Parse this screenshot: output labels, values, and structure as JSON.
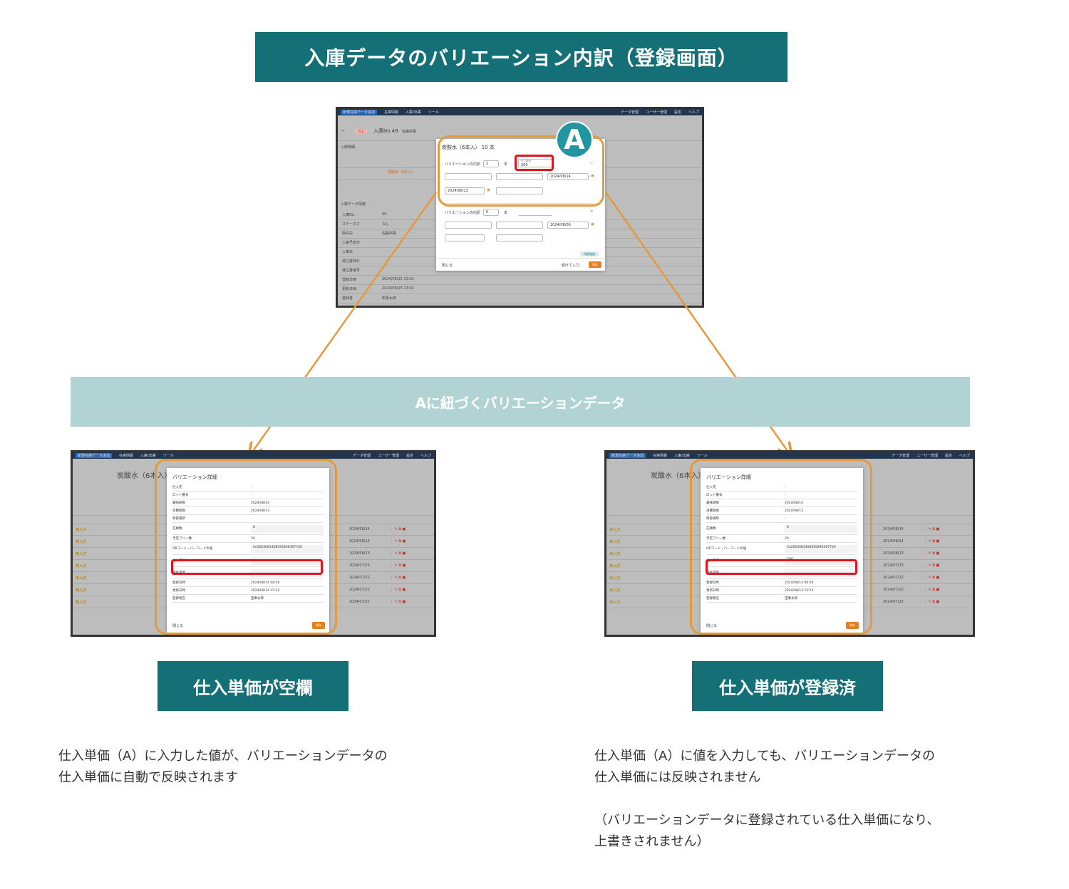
{
  "title": "入庫データのバリエーション内訳（登録画面）",
  "subtitle": "Aに紐づくバリエーションデータ",
  "marker": "A",
  "labels": {
    "left": "仕入単価が空欄",
    "right": "仕入単価が登録済"
  },
  "descriptions": {
    "left_line1": "仕入単価（A）に入力した値が、バリエーションデータの",
    "left_line2": "仕入単価に自動で反映されます",
    "right_line1": "仕入単価（A）に値を入力しても、バリエーションデータの",
    "right_line2": "仕入単価には反映されません",
    "right_line3": "（バリエーションデータに登録されている仕入単価になり、",
    "right_line4": "上書きされません）"
  },
  "app": {
    "nav": {
      "new": "新規在庫データ追加",
      "stock": "在庫情報",
      "inout": "入庫/出庫",
      "tools": "ツール",
      "data": "データ管理",
      "users": "ユーザー管理",
      "settings": "設定",
      "help": "ヘルプ"
    }
  },
  "top_shot": {
    "status": "なし",
    "header": "入庫No.49",
    "company": "佐藤商事",
    "section_items": "入庫明細",
    "section_info": "入庫データ情報",
    "info_rows": [
      {
        "k": "入庫No.",
        "v": "49"
      },
      {
        "k": "ステータス",
        "v": "なし"
      },
      {
        "k": "取引先",
        "v": "佐藤商事"
      },
      {
        "k": "入庫予定日",
        "v": ""
      },
      {
        "k": "入庫日",
        "v": ""
      },
      {
        "k": "発注書発行",
        "v": ""
      },
      {
        "k": "発注書番号",
        "v": ""
      },
      {
        "k": "登録日時",
        "v": "2024/08/15 13:02"
      },
      {
        "k": "更新日時",
        "v": "2024/08/15 13:02"
      },
      {
        "k": "登録者",
        "v": "田事太郎"
      }
    ],
    "modal": {
      "title": "炭酸水（6本入） 10 本",
      "breakdown_label": "バリエーションの内訳",
      "qty1": "2",
      "unit": "本",
      "price_label": "仕入単価",
      "price": "200",
      "date1": "2024/08/14",
      "date2": "2024/08/13",
      "qty2": "0",
      "date3": "2024/08/06",
      "add_label": "内訳追加",
      "close": "閉じる",
      "continue": "続けて入力",
      "save": "保存"
    }
  },
  "detail_shot": {
    "product": "炭酸水（6本入）",
    "modal_title": "バリエーション詳細",
    "rows": [
      {
        "k": "仕入先",
        "v": "-"
      },
      {
        "k": "ロット番号",
        "v": "-"
      },
      {
        "k": "賞味期限",
        "v": "2024/08/14"
      },
      {
        "k": "消費期限",
        "v": "2024/08/13"
      },
      {
        "k": "保管場所",
        "v": "-"
      },
      {
        "k": "在庫数",
        "v": "0"
      },
      {
        "k": "予定フリー数",
        "v": "20"
      },
      {
        "k": "QRコード・バーコードの値",
        "v": "hn2024081408595896367740"
      },
      {
        "k": "仕入単価",
        "v": ""
      },
      {
        "k": "特長単価",
        "v": ""
      },
      {
        "k": "登録日時",
        "v": "2024/08/14 08:59"
      },
      {
        "k": "更新日時",
        "v": "2024/08/14 15:54"
      },
      {
        "k": "登録者名",
        "v": "田事太郎"
      }
    ],
    "right_price": "200",
    "close": "閉じる",
    "save": "保存",
    "warn": "未入力",
    "dates": [
      "2024/08/14",
      "2024/08/14",
      "2024/08/13",
      "2024/07/23",
      "2024/07/22",
      "2024/07/22",
      "2024/07/22"
    ]
  },
  "colors": {
    "teal": "#156f76",
    "light_teal": "#b2d3d4",
    "orange": "#e39a3b",
    "red": "#e0151f",
    "marker": "#2096a0"
  }
}
